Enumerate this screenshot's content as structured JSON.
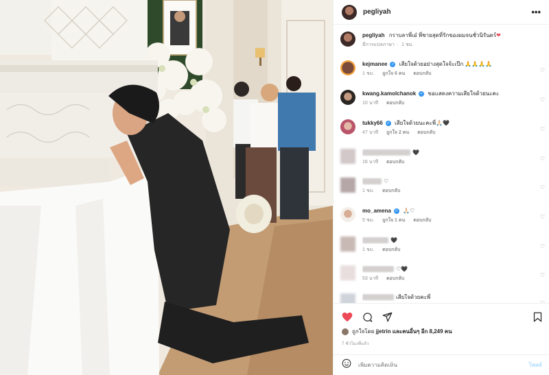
{
  "header": {
    "username": "pegliyah",
    "more_icon": "more-horizontal-icon"
  },
  "caption": {
    "username": "pegliyah",
    "text": "กราบลาพี่เอ๋ พี่ชายสุดที่รักของผมจนชั่วนิรันดร์",
    "heart": "❤",
    "meta_translate": "มีการแปลภาษา",
    "meta_time": "1 ชม."
  },
  "comments": [
    {
      "username": "kejmanee",
      "verified": true,
      "text": "เสียใจด้วยอย่างสุดใจจ้ะเป๊ก 🙏🙏🙏🙏",
      "time": "1 ชม.",
      "likes": "ถูกใจ 6 คน",
      "reply": "ตอบกลับ"
    },
    {
      "username": "kwang.kamolchanok",
      "verified": true,
      "text": "ขอแสดงความเสียใจด้วยนะคะ",
      "time": "10 นาที",
      "likes": "",
      "reply": "ตอบกลับ"
    },
    {
      "username": "tukky66",
      "verified": true,
      "text": "เสียใจด้วยนะคะพี่🙏🏻🖤",
      "time": "47 นาที",
      "likes": "ถูกใจ 2 คน",
      "reply": "ตอบกลับ"
    },
    {
      "username": "",
      "verified": false,
      "text": "🖤",
      "time": "16 นาที",
      "likes": "",
      "reply": "ตอบกลับ"
    },
    {
      "username": "",
      "verified": false,
      "text": "♡",
      "time": "1 ชม.",
      "likes": "",
      "reply": "ตอบกลับ"
    },
    {
      "username": "mo_amena",
      "verified": true,
      "text": "🙏🏻♡",
      "time": "5 ชม.",
      "likes": "ถูกใจ 1 คน",
      "reply": "ตอบกลับ"
    },
    {
      "username": "",
      "verified": false,
      "text": "🖤",
      "time": "1 ชม.",
      "likes": "",
      "reply": "ตอบกลับ"
    },
    {
      "username": "",
      "verified": false,
      "text": "♡🖤",
      "time": "53 นาที",
      "likes": "",
      "reply": "ตอบกลับ"
    },
    {
      "username": "",
      "verified": false,
      "text": "เสียใจด้วยคะพี่",
      "time": "",
      "likes": "",
      "reply": ""
    }
  ],
  "actions": {
    "like_icon": "heart-filled-icon",
    "comment_icon": "comment-icon",
    "share_icon": "share-icon",
    "save_icon": "bookmark-icon",
    "liked_by_prefix": "ถูกใจโดย",
    "liked_by_user": "jjetrin",
    "liked_by_suffix": "และคนอื่นๆ อีก 8,249 คน",
    "posted_time": "7 ชั่วโมงที่แล้ว"
  },
  "add_comment": {
    "emoji_icon": "smiley-icon",
    "placeholder": "เพิ่มความคิดเห็น",
    "post_label": "โพสต์"
  },
  "colors": {
    "like_red": "#ed4956",
    "verified_blue": "#3897f0",
    "post_blue": "#b2dffc",
    "muted": "#8e8e8e"
  }
}
